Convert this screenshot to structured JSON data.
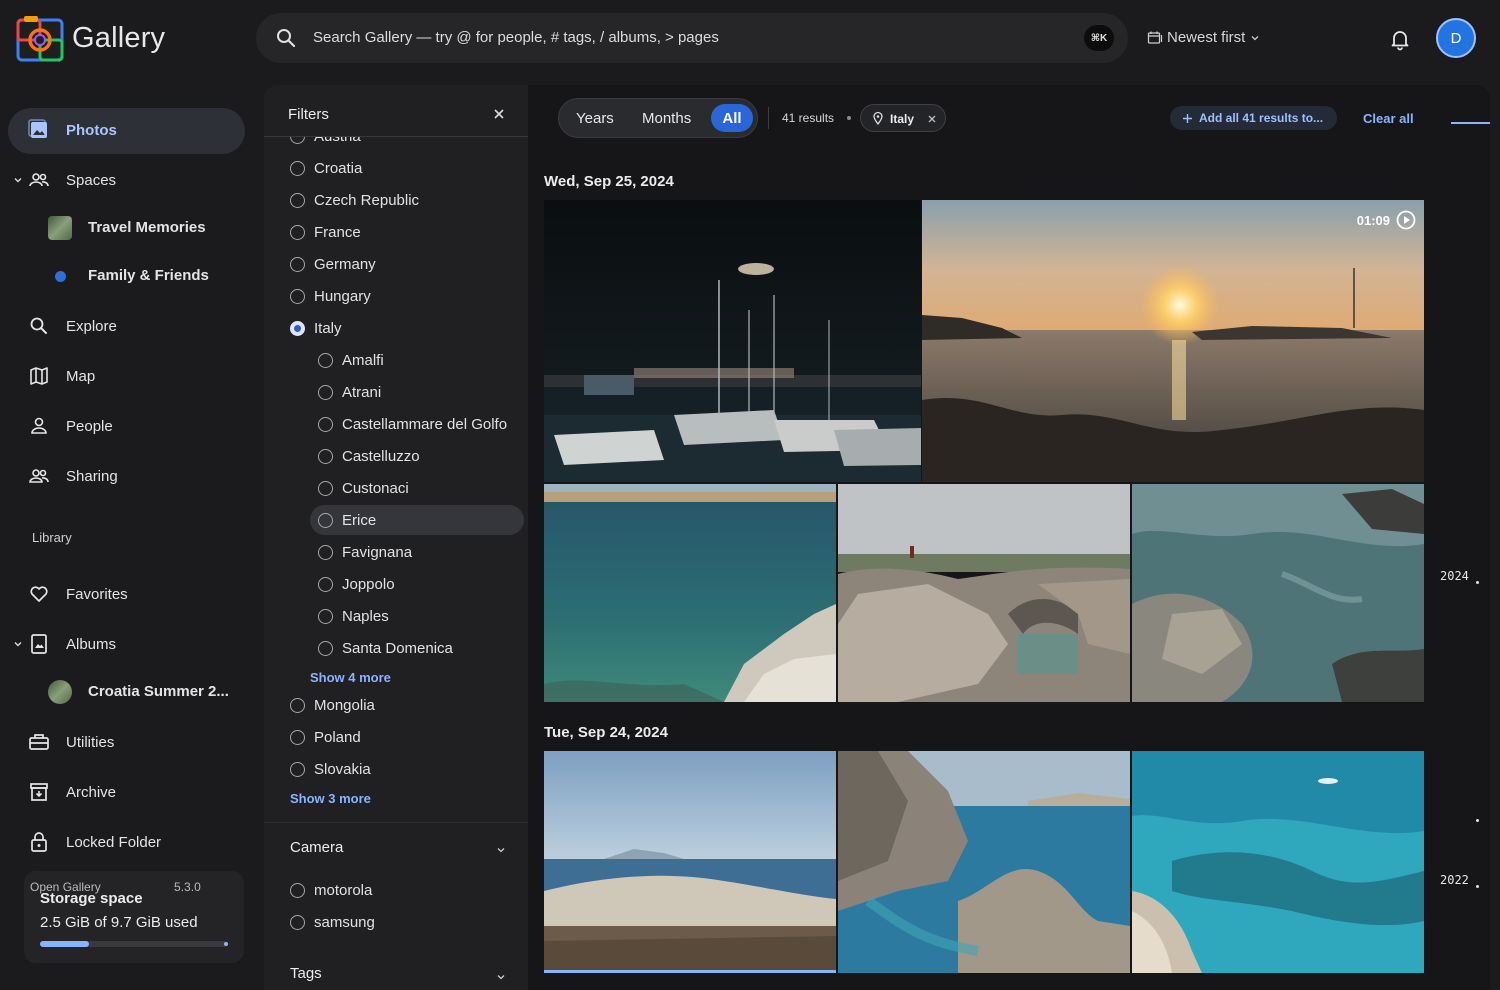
{
  "app": {
    "name": "Gallery"
  },
  "header": {
    "search_placeholder": "Search Gallery — try @ for people, # tags, / albums, > pages",
    "search_shortcut": "⌘K",
    "sort_label": "Newest first",
    "avatar_initial": "D"
  },
  "sidebar": {
    "photos": "Photos",
    "spaces": "Spaces",
    "travel_memories": "Travel Memories",
    "family_friends": "Family & Friends",
    "explore": "Explore",
    "map": "Map",
    "people": "People",
    "sharing": "Sharing",
    "library_label": "Library",
    "favorites": "Favorites",
    "albums": "Albums",
    "croatia_album": "Croatia Summer 2...",
    "utilities": "Utilities",
    "archive": "Archive",
    "locked_folder": "Locked Folder",
    "storage": {
      "title": "Storage space",
      "value": "2.5 GiB of 9.7 GiB used",
      "used_fraction": 0.26
    },
    "footer_left": "Open Gallery",
    "footer_version": "5.3.0"
  },
  "filters": {
    "title": "Filters",
    "countries_top": [
      "Austria",
      "Croatia",
      "Czech Republic",
      "France",
      "Germany",
      "Hungary",
      "Italy"
    ],
    "selected_country": "Italy",
    "italy_places": [
      "Amalfi",
      "Atrani",
      "Castellammare del Golfo",
      "Castelluzzo",
      "Custonaci",
      "Erice",
      "Favignana",
      "Joppolo",
      "Naples",
      "Santa Domenica"
    ],
    "hovered_place": "Erice",
    "show_more_places": "Show 4 more",
    "countries_bottom": [
      "Mongolia",
      "Poland",
      "Slovakia"
    ],
    "show_more_countries": "Show 3 more",
    "camera_title": "Camera",
    "cameras": [
      "motorola",
      "samsung"
    ],
    "tags_title": "Tags"
  },
  "main": {
    "view_modes": [
      "Years",
      "Months",
      "All"
    ],
    "active_view": "All",
    "results_count": "41 results",
    "location_chip": "Italy",
    "add_all_label": "Add all 41 results to...",
    "clear_all": "Clear all",
    "groups": [
      {
        "date": "Wed, Sep 25, 2024"
      },
      {
        "date": "Tue, Sep 24, 2024"
      }
    ],
    "video_duration": "01:09",
    "timeline_years": [
      "2024",
      "2022"
    ]
  },
  "colors": {
    "accent": "#8ab4ff",
    "active_blue": "#2b66d9",
    "background": "#1b1b1d"
  }
}
